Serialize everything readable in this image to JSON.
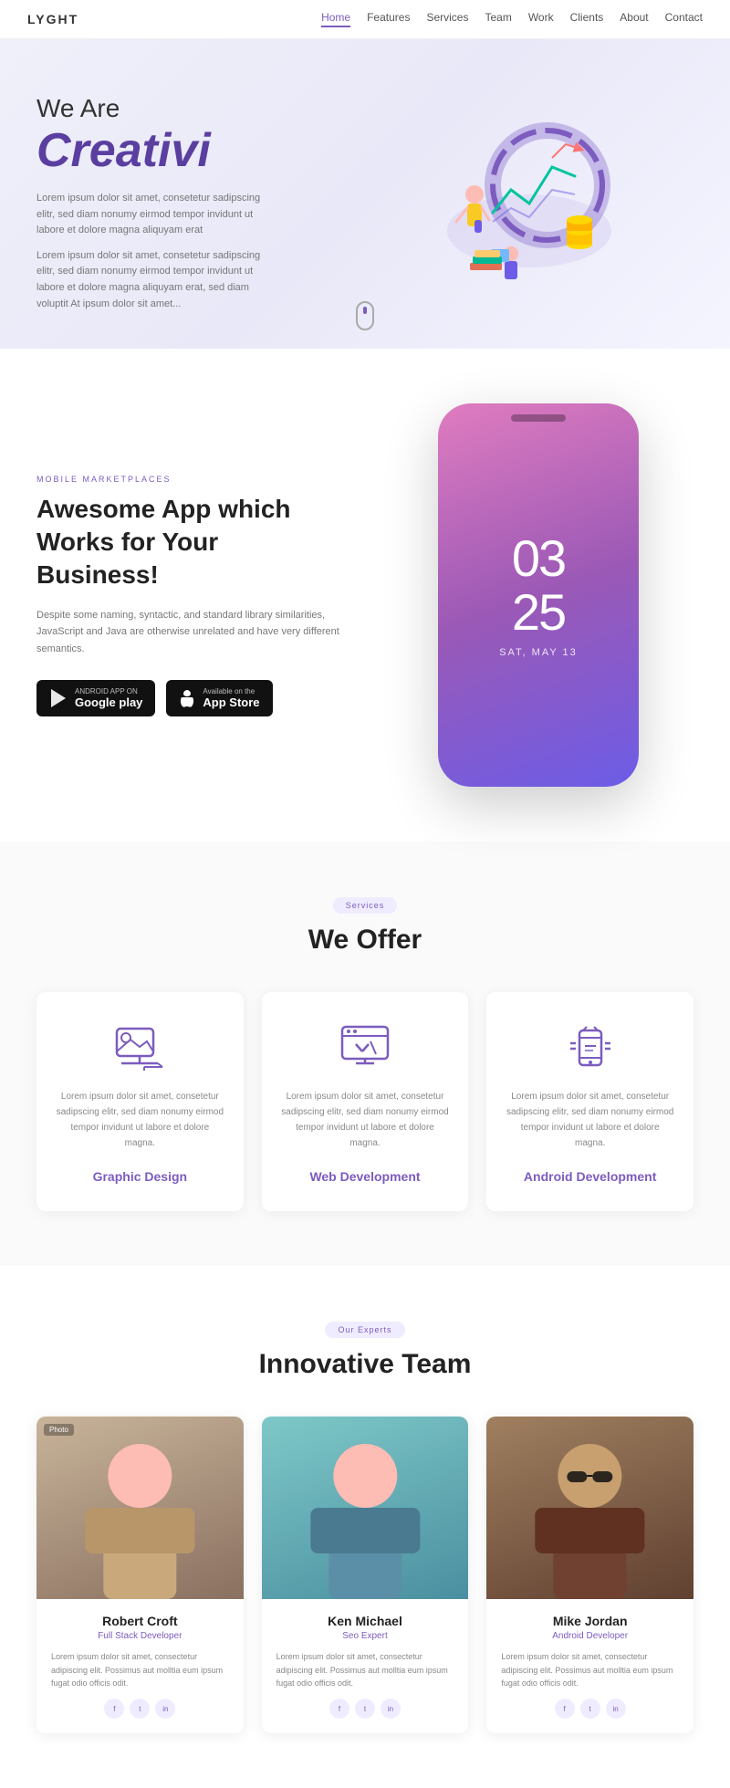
{
  "nav": {
    "logo": "LYGHT",
    "links": [
      "Home",
      "Features",
      "Services",
      "Team",
      "Work",
      "Clients",
      "About",
      "Contact"
    ],
    "active": "Home"
  },
  "hero": {
    "pre_text": "We Are",
    "creative_text": "Creativi",
    "paragraph1": "Lorem ipsum dolor sit amet, consetetur sadipscing elitr, sed diam nonumy eirmod tempor invidunt ut labore et dolore magna aliquyam erat",
    "paragraph2": "Lorem ipsum dolor sit amet, consetetur sadipscing elitr, sed diam nonumy eirmod tempor invidunt ut labore et dolore magna aliquyam erat, sed diam voluptit At ipsum dolor sit amet..."
  },
  "mobile_section": {
    "label": "MOBILE MARKETPLACES",
    "heading": "Awesome App which Works for Your Business!",
    "description": "Despite some naming, syntactic, and standard library similarities, JavaScript and Java are otherwise unrelated and have very different semantics.",
    "btn_google": "Google play",
    "btn_google_pre": "ANDROID APP ON",
    "btn_apple": "App Store",
    "btn_apple_pre": "Available on the",
    "phone_time": "03\n25",
    "phone_date": "SAT, MAY 13"
  },
  "services": {
    "tag": "Services",
    "title": "We Offer",
    "items": [
      {
        "name": "Graphic Design",
        "desc": "Lorem ipsum dolor sit amet, consetetur sadipscing elitr, sed diam nonumy eirmod tempor invidunt ut labore et dolore magna."
      },
      {
        "name": "Web Development",
        "desc": "Lorem ipsum dolor sit amet, consetetur sadipscing elitr, sed diam nonumy eirmod tempor invidunt ut labore et dolore magna."
      },
      {
        "name": "Android Development",
        "desc": "Lorem ipsum dolor sit amet, consetetur sadipscing elitr, sed diam nonumy eirmod tempor invidunt ut labore et dolore magna."
      }
    ]
  },
  "team": {
    "tag": "Our Experts",
    "title": "Innovative Team",
    "members": [
      {
        "name": "Robert Croft",
        "role": "Full Stack Developer",
        "bio": "Lorem ipsum dolor sit amet, consectetur adipiscing elit. Possimus aut molltia eum ipsum fugat odio officis odit.",
        "photo_bg": "#c8b89a"
      },
      {
        "name": "Ken Michael",
        "role": "Seo Expert",
        "bio": "Lorem ipsum dolor sit amet, consectetur adipiscing elit. Possimus aut molltia eum ipsum fugat odio officis odit.",
        "photo_bg": "#7ba8b5"
      },
      {
        "name": "Mike Jordan",
        "role": "Android Developer",
        "bio": "Lorem ipsum dolor sit amet, consectetur adipiscing elit. Possimus aut molltia eum ipsum fugat odio officis odit.",
        "photo_bg": "#8a7060"
      }
    ]
  }
}
